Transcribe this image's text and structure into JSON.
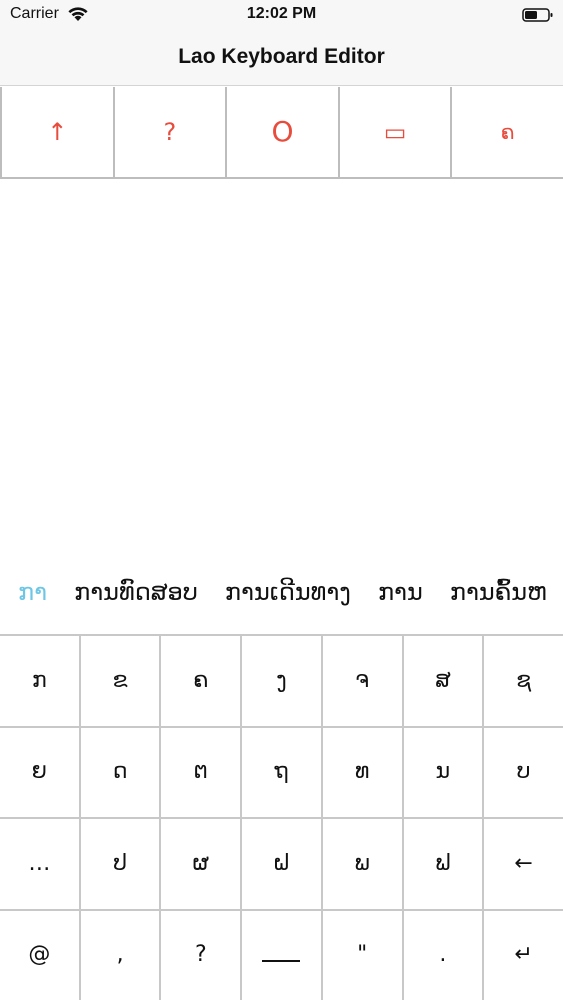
{
  "status_bar": {
    "carrier": "Carrier",
    "time": "12:02 PM"
  },
  "nav": {
    "title": "Lao Keyboard Editor"
  },
  "toolbar": {
    "accent_color": "#e74c3c",
    "buttons": [
      {
        "label": "↑",
        "icon": "arrow-up-icon"
      },
      {
        "label": "?",
        "icon": "question-icon"
      },
      {
        "label": "O",
        "icon": "circle-icon"
      },
      {
        "label": "▭",
        "icon": "rounded-rect-icon"
      },
      {
        "label": "ຄ",
        "icon": "lao-letter-icon"
      }
    ]
  },
  "suggestions": {
    "active_color": "#6cc6e4",
    "items": [
      {
        "text": "ກາ",
        "active": true
      },
      {
        "text": "ການທົດສອບ",
        "active": false
      },
      {
        "text": "ການເດີນທາງ",
        "active": false
      },
      {
        "text": "ການ",
        "active": false
      },
      {
        "text": "ການຄົ້ນຫ",
        "active": false
      }
    ]
  },
  "keyboard": {
    "rows": [
      [
        "ກ",
        "ຂ",
        "ຄ",
        "ງ",
        "ຈ",
        "ສ",
        "ຊ"
      ],
      [
        "ຍ",
        "ດ",
        "ຕ",
        "ຖ",
        "ທ",
        "ນ",
        "ບ"
      ],
      [
        "…",
        "ປ",
        "ຜ",
        "ຝ",
        "ພ",
        "ຟ",
        "←"
      ],
      [
        "@",
        ",",
        "?",
        "",
        "\"",
        ".",
        "↵"
      ]
    ]
  }
}
